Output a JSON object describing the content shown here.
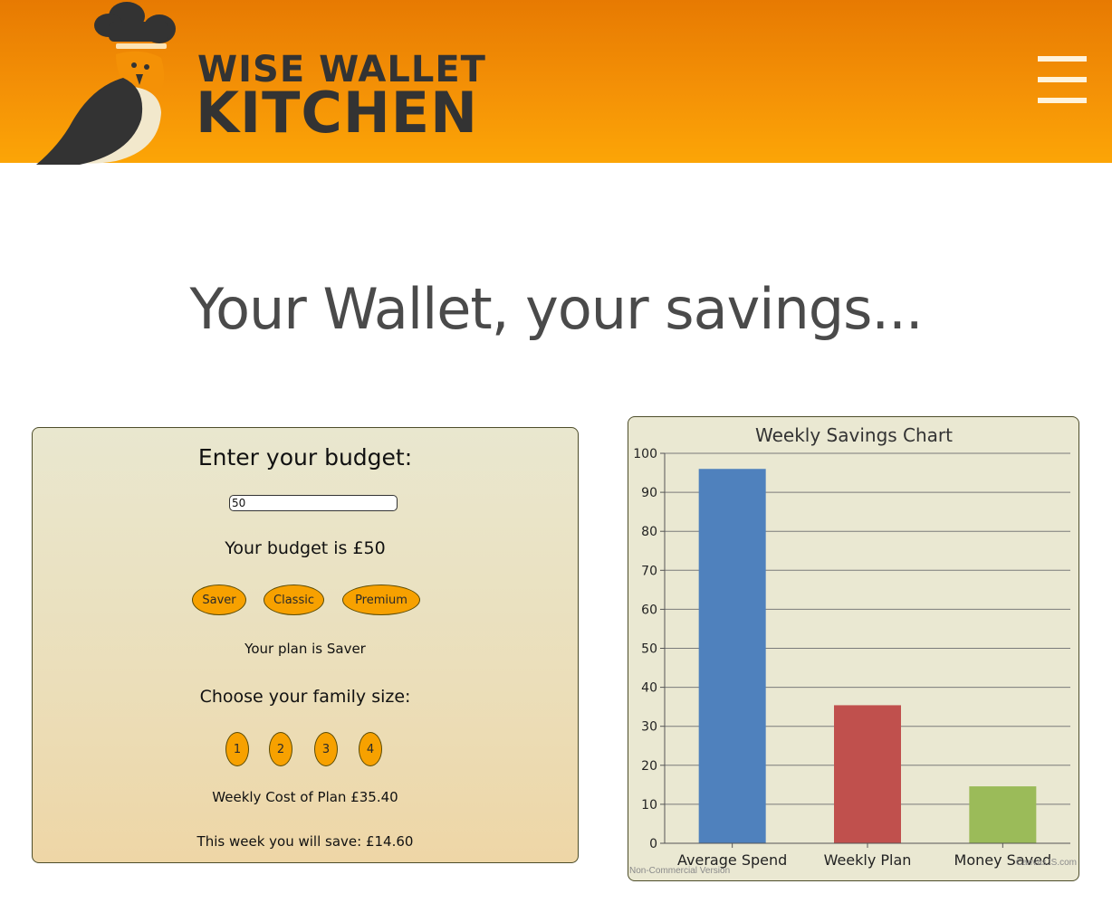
{
  "header": {
    "brand_line1": "WISE WALLET",
    "brand_line2": "KITCHEN",
    "menu_icon": "hamburger-menu-icon",
    "logo_icon": "chef-parrot-logo",
    "background_color": "#f49106"
  },
  "main": {
    "title": "Your Wallet, your savings..."
  },
  "budget_panel": {
    "heading": "Enter your budget:",
    "budget_input_value": "50",
    "budget_text": "Your budget is £50",
    "plan_buttons": [
      "Saver",
      "Classic",
      "Premium"
    ],
    "plan_text": "Your plan is Saver",
    "family_heading": "Choose your family size:",
    "family_buttons": [
      "1",
      "2",
      "3",
      "4"
    ],
    "weekly_cost_text": "Weekly Cost of Plan £35.40",
    "weekly_save_text": "This week you will save: £14.60",
    "button_color": "#f7a100"
  },
  "chart_data": {
    "type": "bar",
    "title": "Weekly Savings Chart",
    "categories": [
      "Average Spend",
      "Weekly Plan",
      "Money Saved"
    ],
    "values": [
      96,
      35.4,
      14.6
    ],
    "colors": [
      "#4f81bd",
      "#c0504d",
      "#9bbb59"
    ],
    "ylim": [
      0,
      100
    ],
    "yticks": [
      0,
      10,
      20,
      30,
      40,
      50,
      60,
      70,
      80,
      90,
      100
    ],
    "grid": true,
    "watermark_left": "Non-Commercial Version",
    "watermark_right": "CanvasJS.com"
  }
}
